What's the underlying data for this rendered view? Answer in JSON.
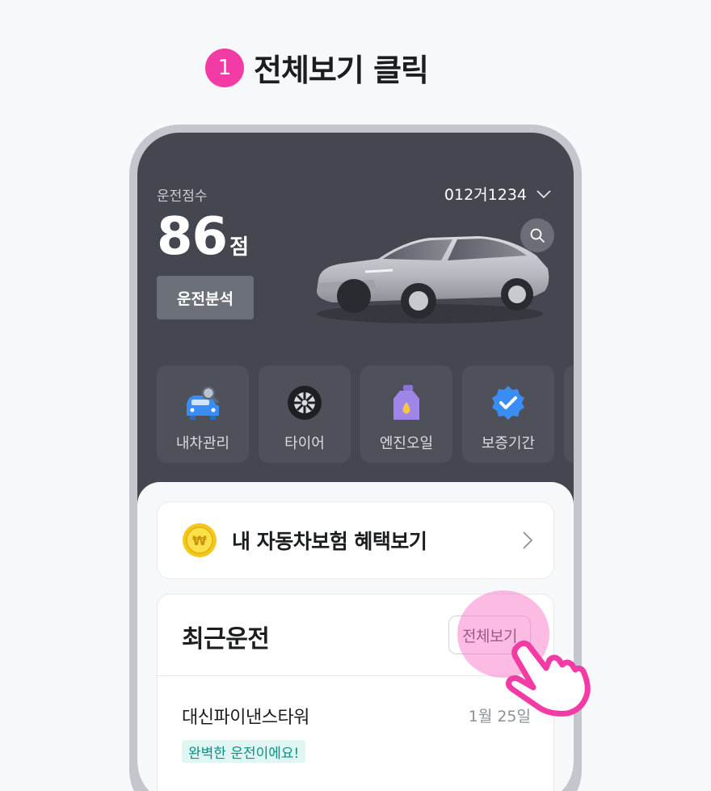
{
  "step": {
    "number": "1",
    "title": "전체보기 클릭"
  },
  "header": {
    "score_label": "운전점수",
    "score_value": "86",
    "score_unit": "점",
    "analysis_button": "운전분석",
    "plate_number": "012거1234"
  },
  "services": [
    {
      "label": "내차관리",
      "icon": "car-search-icon"
    },
    {
      "label": "타이어",
      "icon": "tire-icon"
    },
    {
      "label": "엔진오일",
      "icon": "oil-bottle-icon"
    },
    {
      "label": "보증기간",
      "icon": "verified-badge-icon"
    }
  ],
  "insurance": {
    "text": "내 자동차보험 혜택보기",
    "icon": "won-coin-icon"
  },
  "recent": {
    "title": "최근운전",
    "view_all_label": "전체보기",
    "trip": {
      "place": "대신파이낸스타워",
      "date": "1월 25일",
      "badge": "완벽한 운전이에요!"
    }
  },
  "colors": {
    "accent_pink": "#f23ba4",
    "dark_panel": "#44474f",
    "badge_bg": "#dff6f3",
    "badge_text": "#0b8f85"
  }
}
